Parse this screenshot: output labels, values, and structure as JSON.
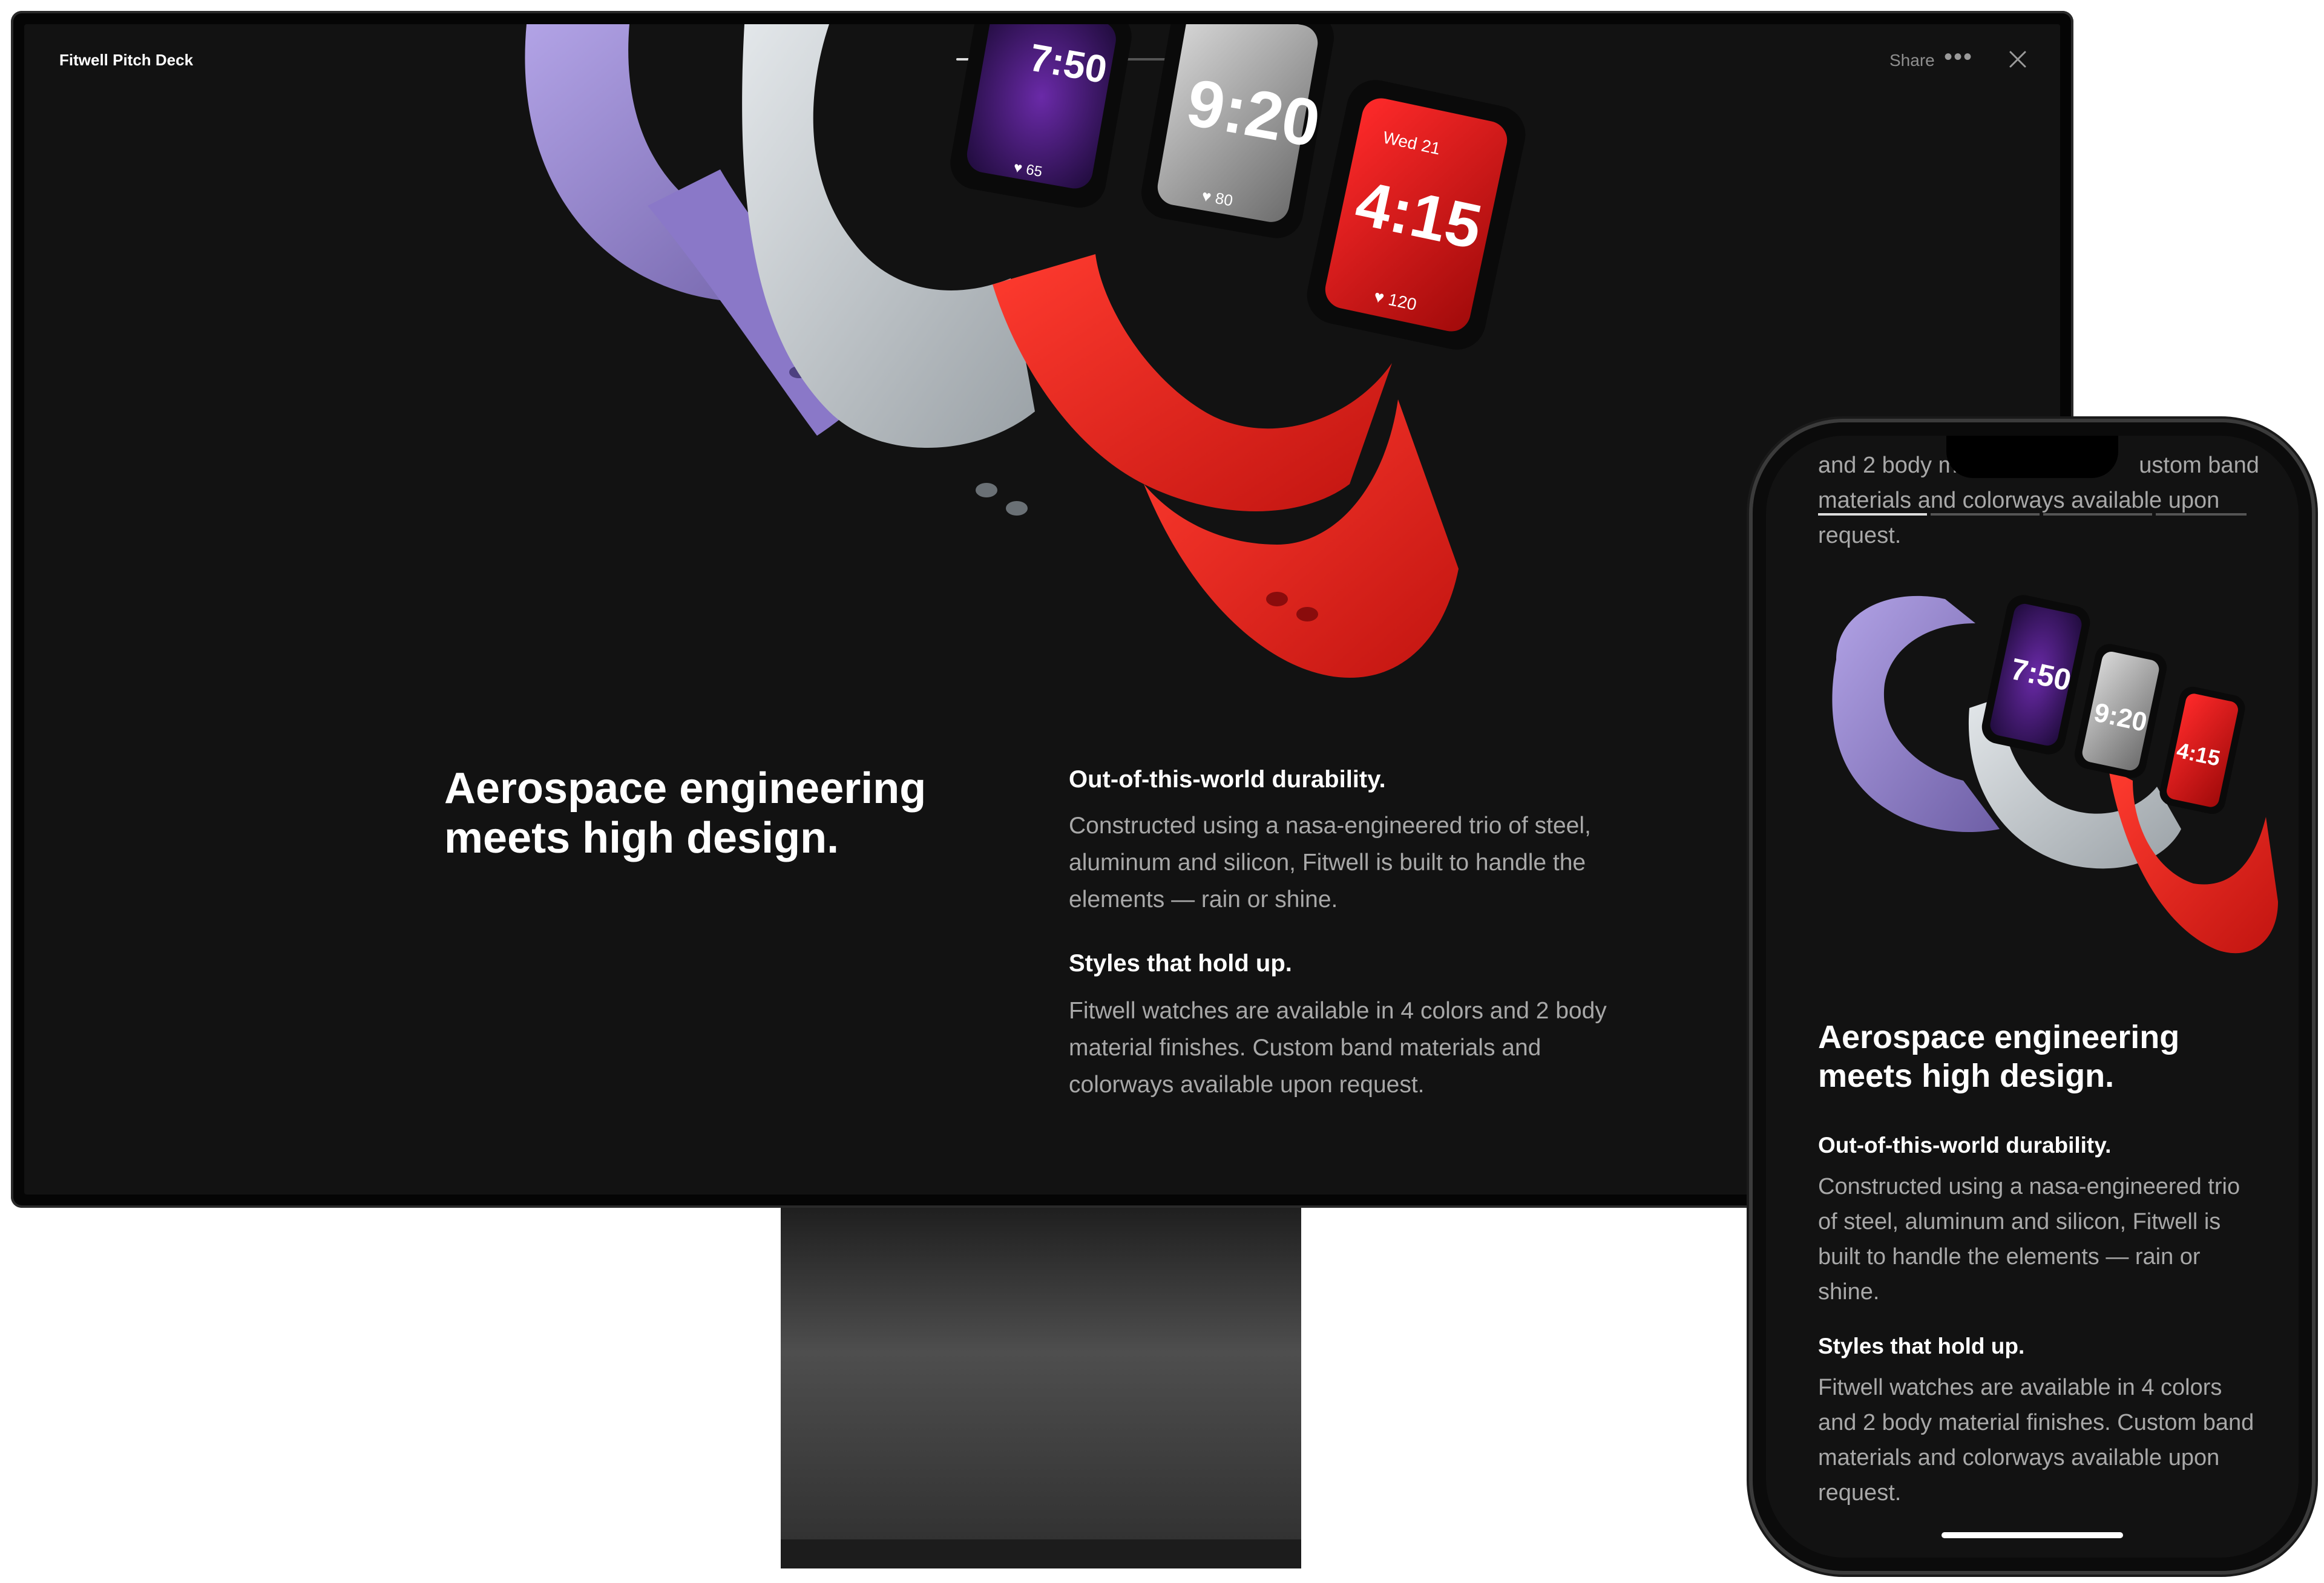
{
  "app": {
    "title": "Fitwell Pitch Deck"
  },
  "toolbar": {
    "share_label": "Share",
    "more_label": "•••"
  },
  "watches": {
    "purple_time": "7:50",
    "purple_heart": "65",
    "silver_time": "9:20",
    "silver_heart": "80",
    "red_date": "Wed 21",
    "red_time": "4:15",
    "red_heart": "120"
  },
  "content": {
    "heading_line1": "Aerospace engineering",
    "heading_line2": "meets high design.",
    "durability_title": "Out-of-this-world durability.",
    "durability_body": "Constructed using a nasa-engineered trio of steel, aluminum and silicon, Fitwell is built to handle the elements — rain or shine.",
    "styles_title": "Styles that hold up.",
    "styles_body": "Fitwell watches are available in 4 colors and 2 body material finishes. Custom band materials and colorways available upon request."
  },
  "desktop_lines": {
    "durability": [
      "Constructed using a nasa-engineered trio of steel,",
      "aluminum and silicon, Fitwell is built to handle the",
      "elements — rain or shine."
    ],
    "styles": [
      "Fitwell watches are available in 4 colors and 2 body",
      "material finishes. Custom band materials and",
      "colorways available upon request."
    ]
  },
  "phone": {
    "top_partial": [
      "and 2 body m",
      "ustom band",
      "materials and colorways available upon",
      "request."
    ],
    "durability": [
      "Constructed using a nasa-engineered trio",
      "of steel, aluminum and silicon, Fitwell is",
      "built to handle the elements — rain or",
      "shine."
    ],
    "styles": [
      "Fitwell watches are available in 4 colors",
      "and 2 body material finishes. Custom band",
      "materials and colorways available upon",
      "request."
    ]
  },
  "colors": {
    "background": "#121212",
    "purple_band": "#9b88d4",
    "silver_band": "#c8cdd0",
    "red_band": "#e8231c"
  }
}
